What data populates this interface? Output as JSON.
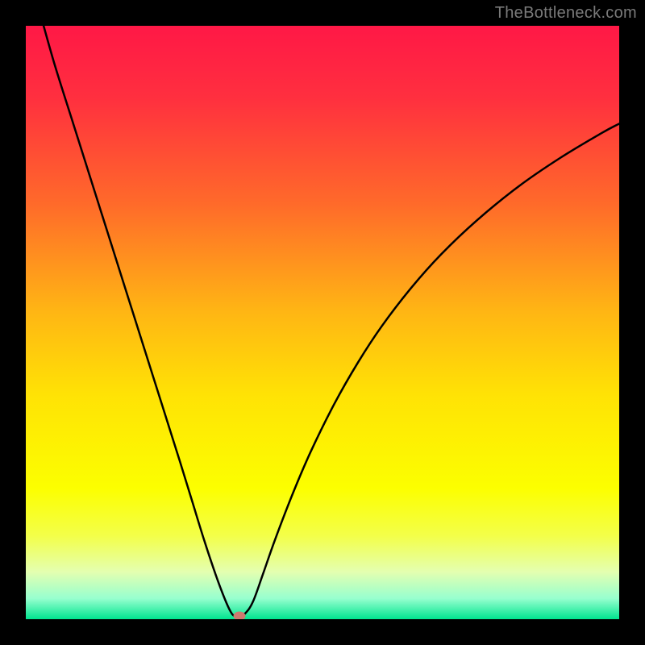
{
  "watermark": {
    "text": "TheBottleneck.com"
  },
  "chart_data": {
    "type": "line",
    "title": "",
    "xlabel": "",
    "ylabel": "",
    "xlim": [
      0,
      100
    ],
    "ylim": [
      0,
      100
    ],
    "grid": false,
    "legend": false,
    "background": {
      "type": "gradient-vertical",
      "stops": [
        {
          "pos": 0.0,
          "color": "#ff1846"
        },
        {
          "pos": 0.12,
          "color": "#ff2f3f"
        },
        {
          "pos": 0.3,
          "color": "#ff6a2a"
        },
        {
          "pos": 0.48,
          "color": "#ffb514"
        },
        {
          "pos": 0.62,
          "color": "#ffe205"
        },
        {
          "pos": 0.78,
          "color": "#fcff00"
        },
        {
          "pos": 0.86,
          "color": "#f3ff4a"
        },
        {
          "pos": 0.92,
          "color": "#e4ffb0"
        },
        {
          "pos": 0.965,
          "color": "#97ffcf"
        },
        {
          "pos": 1.0,
          "color": "#00e58f"
        }
      ]
    },
    "series": [
      {
        "name": "bottleneck-curve",
        "color": "#000000",
        "width": 2.5,
        "x": [
          3,
          5,
          8,
          11,
          14,
          17,
          20,
          23,
          26,
          28,
          30,
          32,
          33.5,
          34.5,
          35.2,
          36.0,
          37.0,
          38.3,
          40,
          42,
          45,
          48,
          52,
          56,
          60,
          65,
          70,
          76,
          83,
          90,
          97,
          100
        ],
        "y": [
          100,
          93,
          83.5,
          74,
          64.5,
          55,
          45.5,
          36,
          26.5,
          20,
          13.5,
          7.5,
          3.5,
          1.3,
          0.5,
          0.5,
          1.0,
          3.0,
          7.7,
          13.4,
          21.2,
          28.2,
          36.3,
          43.3,
          49.4,
          55.9,
          61.5,
          67.2,
          72.9,
          77.7,
          81.9,
          83.5
        ]
      }
    ],
    "marker": {
      "name": "optimal-point",
      "x": 36,
      "y": 0.5,
      "color": "#cd7a6f"
    }
  }
}
